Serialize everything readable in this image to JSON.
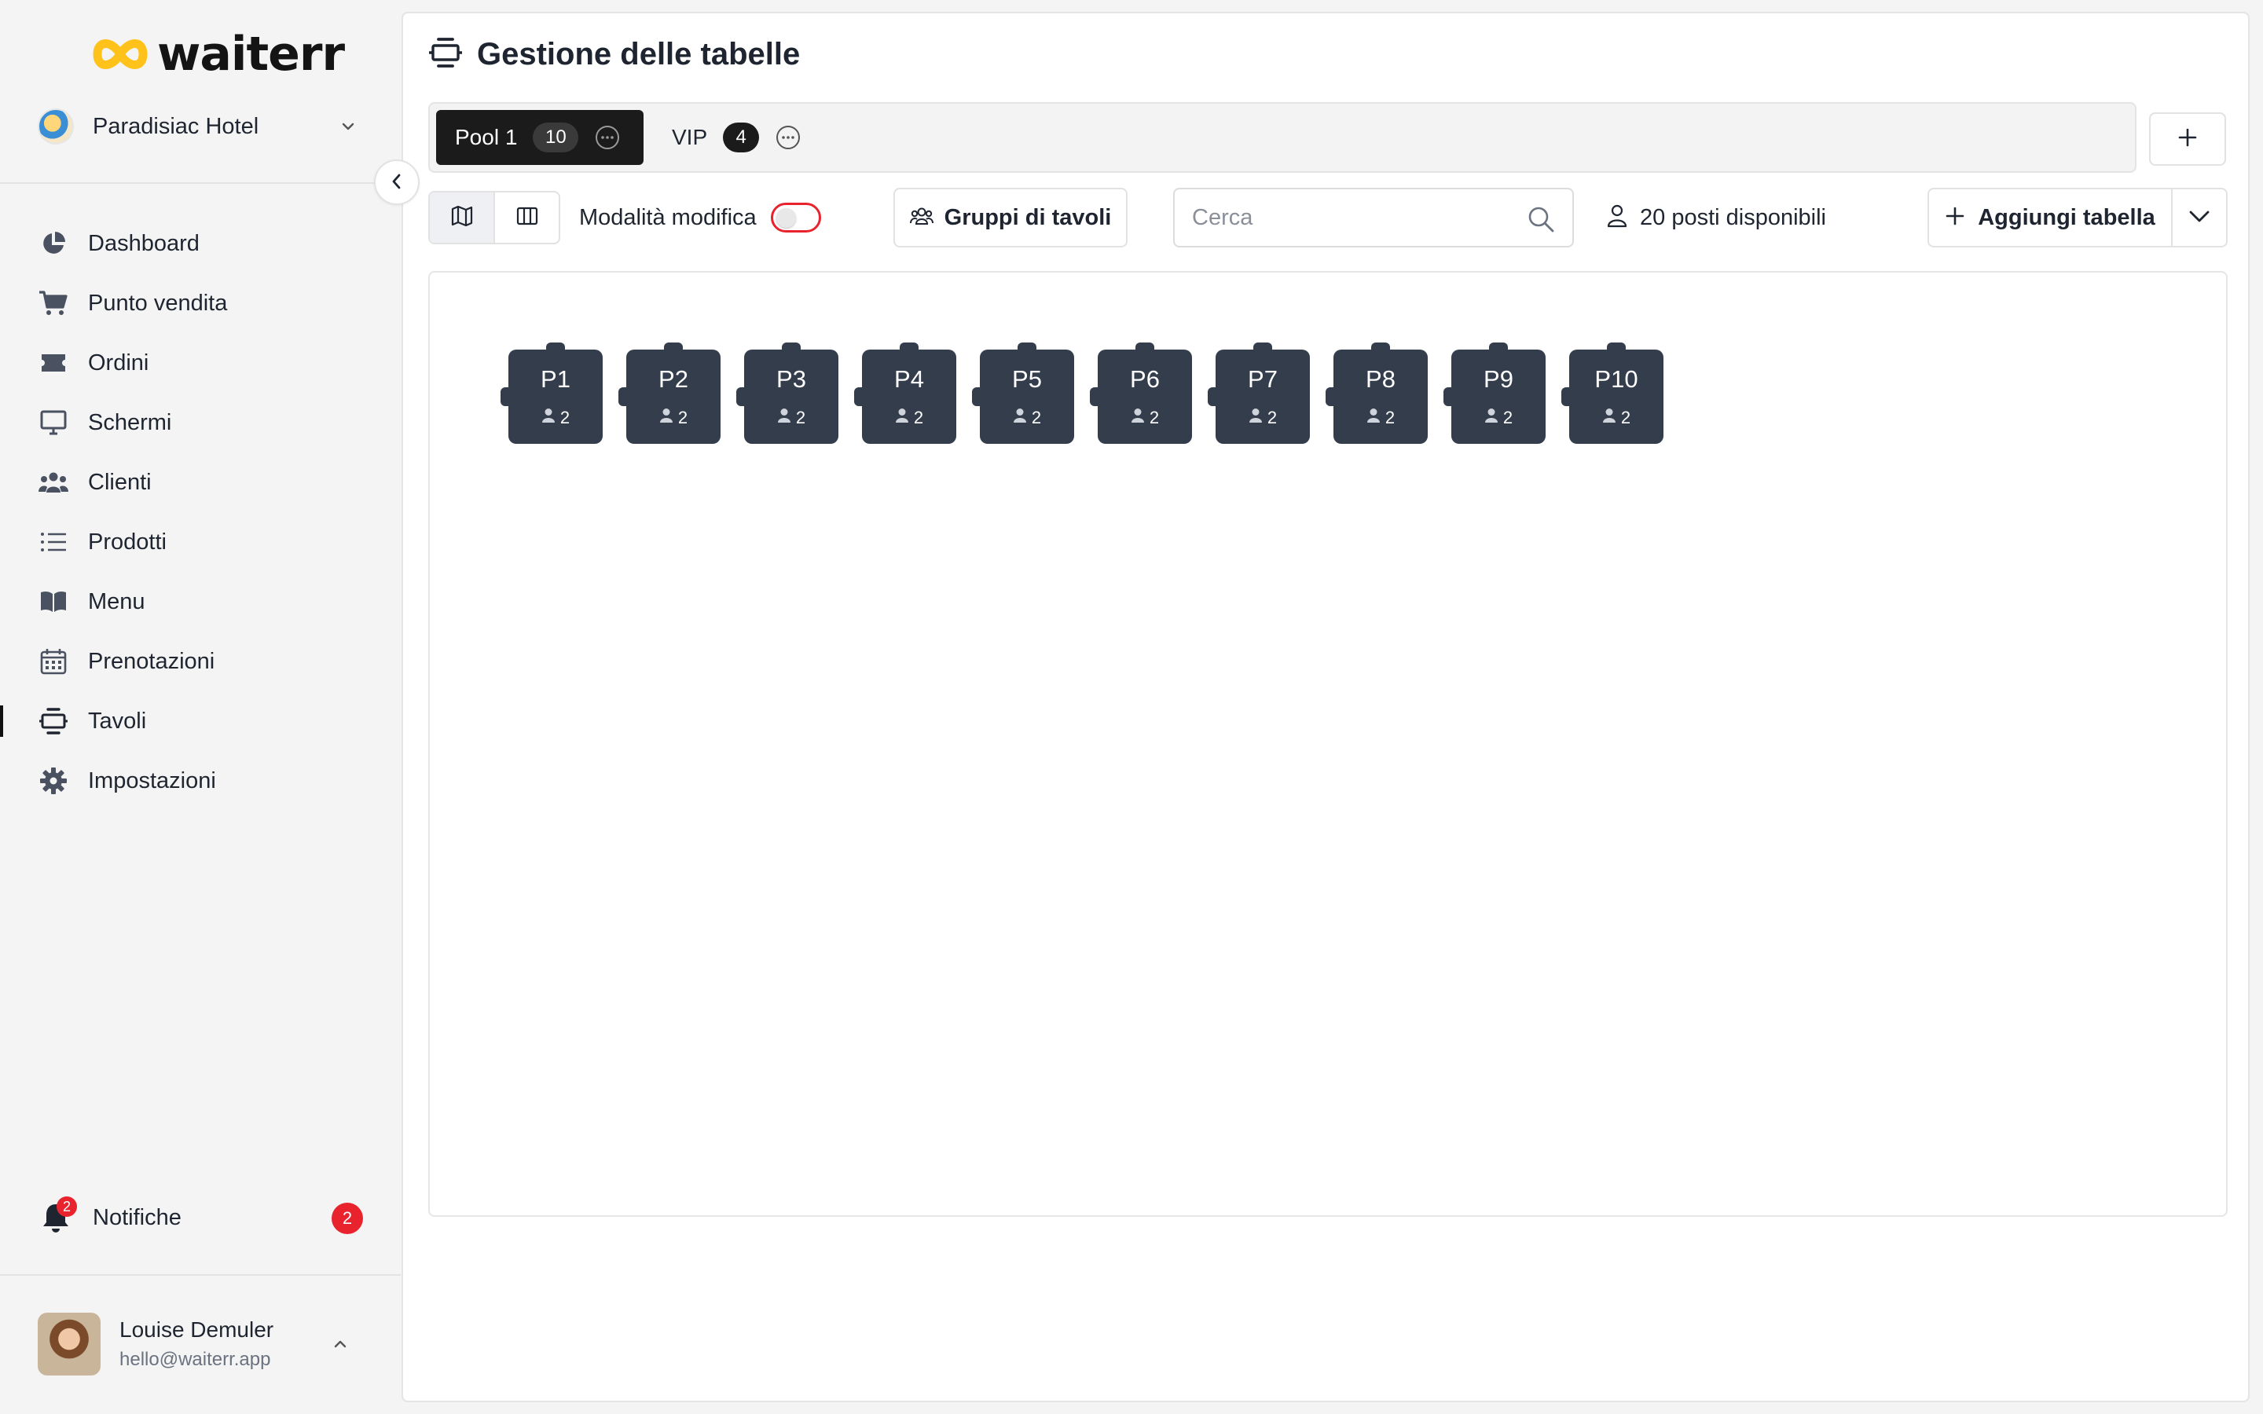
{
  "app": {
    "logo_text": "waiterr"
  },
  "venue": {
    "name": "Paradisiac Hotel"
  },
  "nav": [
    {
      "label": "Dashboard",
      "icon": "pie-chart-icon"
    },
    {
      "label": "Punto vendita",
      "icon": "cart-icon"
    },
    {
      "label": "Ordini",
      "icon": "ticket-icon"
    },
    {
      "label": "Schermi",
      "icon": "monitor-icon"
    },
    {
      "label": "Clienti",
      "icon": "users-icon"
    },
    {
      "label": "Prodotti",
      "icon": "list-icon"
    },
    {
      "label": "Menu",
      "icon": "book-icon"
    },
    {
      "label": "Prenotazioni",
      "icon": "calendar-icon"
    },
    {
      "label": "Tavoli",
      "icon": "table-icon",
      "active": true
    },
    {
      "label": "Impostazioni",
      "icon": "gear-icon"
    }
  ],
  "notifications": {
    "label": "Notifiche",
    "icon_badge": "2",
    "count": "2"
  },
  "user": {
    "name": "Louise Demuler",
    "email": "hello@waiterr.app"
  },
  "page": {
    "title": "Gestione delle tabelle"
  },
  "tabs": [
    {
      "label": "Pool 1",
      "count": "10",
      "active": true
    },
    {
      "label": "VIP",
      "count": "4",
      "active": false
    }
  ],
  "toolbar": {
    "edit_mode_label": "Modalità modifica",
    "edit_mode_on": false,
    "groups_label": "Gruppi di tavoli",
    "search_placeholder": "Cerca",
    "seats_label": "20 posti disponibili",
    "add_table_label": "Aggiungi tabella"
  },
  "tables": [
    {
      "name": "P1",
      "seats": "2"
    },
    {
      "name": "P2",
      "seats": "2"
    },
    {
      "name": "P3",
      "seats": "2"
    },
    {
      "name": "P4",
      "seats": "2"
    },
    {
      "name": "P5",
      "seats": "2"
    },
    {
      "name": "P6",
      "seats": "2"
    },
    {
      "name": "P7",
      "seats": "2"
    },
    {
      "name": "P8",
      "seats": "2"
    },
    {
      "name": "P9",
      "seats": "2"
    },
    {
      "name": "P10",
      "seats": "2"
    }
  ],
  "colors": {
    "accent_red": "#e8232e",
    "table_fill": "#333d4c",
    "logo_yellow": "#ffc21a",
    "active_tab": "#1b1b1b"
  }
}
